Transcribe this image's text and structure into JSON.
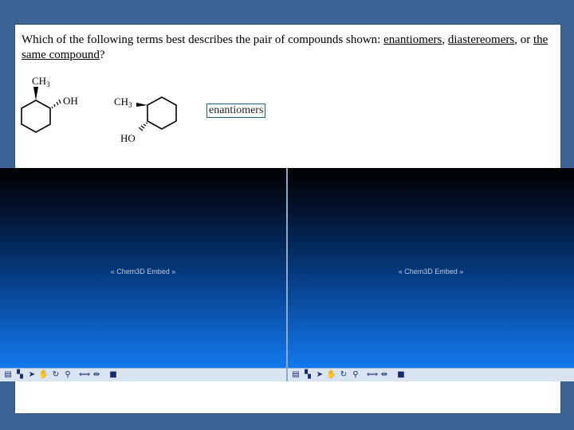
{
  "question": {
    "prefix": "Which of the following terms best describes the pair of compounds shown: ",
    "opt1": "enantiomers",
    "sep1": ", ",
    "opt2": "diastereomers",
    "sep2": ", or ",
    "opt3": "the same compound",
    "suffix": "?"
  },
  "molecules": {
    "left_top": "CH",
    "left_top_sub": "3",
    "left_oh": "OH",
    "right_ch": "CH",
    "right_ch_sub": "3",
    "right_ho": "HO"
  },
  "answer": "enantiomers",
  "panes": [
    {
      "embed_label": "« Chem3D Embed »"
    },
    {
      "embed_label": "« Chem3D Embed »"
    }
  ],
  "toolbar_icons": [
    "document-icon",
    "model-icon",
    "select-arrow-icon",
    "hand-icon",
    "rotate-icon",
    "bond-icon",
    "translate-icon",
    "width-icon",
    "stop-icon"
  ],
  "colors": {
    "background": "#3c6494",
    "pane_gradient_top": "#000000",
    "pane_gradient_bottom": "#1478ee",
    "link": "#000000"
  }
}
